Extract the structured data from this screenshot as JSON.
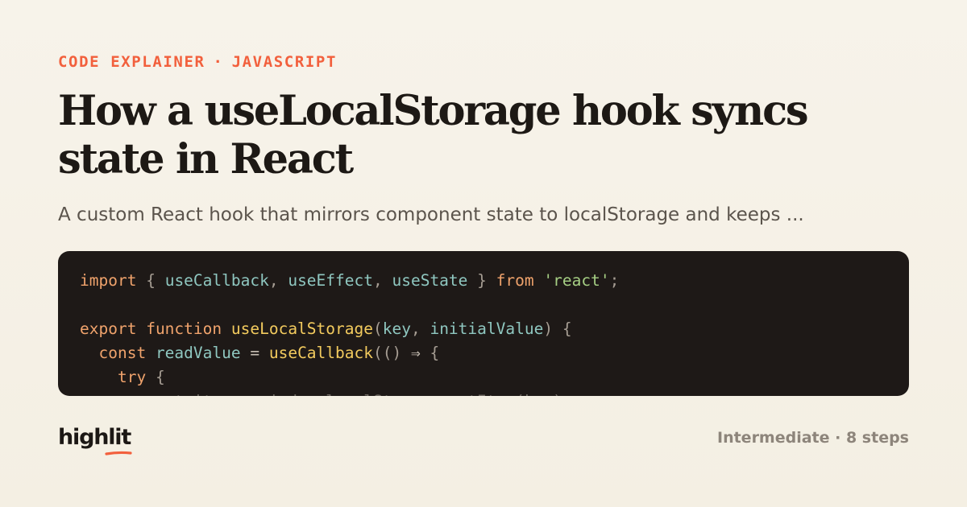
{
  "eyebrow": {
    "category": "CODE EXPLAINER",
    "separator": "·",
    "language": "JAVASCRIPT"
  },
  "title": "How a useLocalStorage hook syncs state in React",
  "subtitle": "A custom React hook that mirrors component state to localStorage and keeps ...",
  "code_lines": [
    [
      {
        "t": "import",
        "c": "kw"
      },
      {
        "t": " ",
        "c": "op"
      },
      {
        "t": "{",
        "c": "pun"
      },
      {
        "t": " ",
        "c": "op"
      },
      {
        "t": "useCallback",
        "c": "id"
      },
      {
        "t": ", ",
        "c": "pun"
      },
      {
        "t": "useEffect",
        "c": "id"
      },
      {
        "t": ", ",
        "c": "pun"
      },
      {
        "t": "useState",
        "c": "id"
      },
      {
        "t": " ",
        "c": "op"
      },
      {
        "t": "}",
        "c": "pun"
      },
      {
        "t": " ",
        "c": "op"
      },
      {
        "t": "from",
        "c": "kw"
      },
      {
        "t": " ",
        "c": "op"
      },
      {
        "t": "'react'",
        "c": "str"
      },
      {
        "t": ";",
        "c": "pun"
      }
    ],
    [],
    [
      {
        "t": "export",
        "c": "kw"
      },
      {
        "t": " ",
        "c": "op"
      },
      {
        "t": "function",
        "c": "kw"
      },
      {
        "t": " ",
        "c": "op"
      },
      {
        "t": "useLocalStorage",
        "c": "fn"
      },
      {
        "t": "(",
        "c": "pun"
      },
      {
        "t": "key",
        "c": "id"
      },
      {
        "t": ", ",
        "c": "pun"
      },
      {
        "t": "initialValue",
        "c": "id"
      },
      {
        "t": ")",
        "c": "pun"
      },
      {
        "t": " ",
        "c": "op"
      },
      {
        "t": "{",
        "c": "pun"
      }
    ],
    [
      {
        "t": "  ",
        "c": "op"
      },
      {
        "t": "const",
        "c": "kw"
      },
      {
        "t": " ",
        "c": "op"
      },
      {
        "t": "readValue",
        "c": "id"
      },
      {
        "t": " = ",
        "c": "op"
      },
      {
        "t": "useCallback",
        "c": "fn"
      },
      {
        "t": "(() ",
        "c": "pun"
      },
      {
        "t": "⇒",
        "c": "op"
      },
      {
        "t": " {",
        "c": "pun"
      }
    ],
    [
      {
        "t": "    ",
        "c": "op"
      },
      {
        "t": "try",
        "c": "kw"
      },
      {
        "t": " {",
        "c": "pun"
      }
    ],
    [
      {
        "t": "      const item = window.localStorage.getItem(key);",
        "c": "dim"
      }
    ]
  ],
  "brand": {
    "logo_text": "highlit",
    "underline_color": "#f2603d"
  },
  "meta": "Intermediate · 8 steps",
  "colors": {
    "accent": "#f2603d",
    "background": "#f6f1e6",
    "code_background": "#1e1917"
  }
}
